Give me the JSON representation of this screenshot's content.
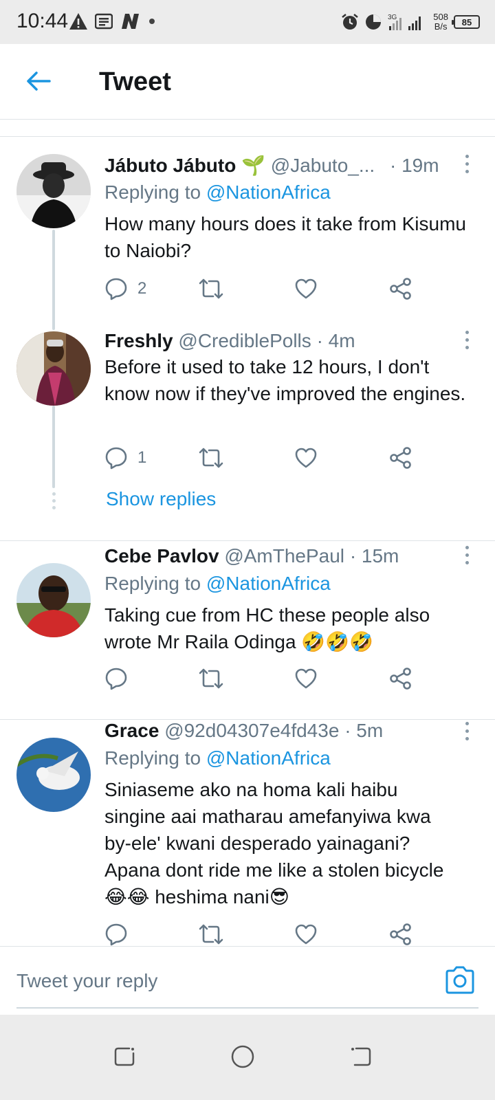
{
  "status_bar": {
    "time": "10:44",
    "net_speed_value": "508",
    "net_speed_unit": "B/s",
    "battery": "85",
    "network": "3G",
    "icons": [
      "warning-icon",
      "news-icon",
      "n-app-icon",
      "dot-icon",
      "alarm-icon",
      "data-saver-icon",
      "signal-icon",
      "battery-icon"
    ]
  },
  "header": {
    "title": "Tweet"
  },
  "tweets": [
    {
      "name": "Jábuto Jábuto",
      "emoji": "🌱",
      "handle": "@Jabuto_...",
      "time": "· 19m",
      "reply_prefix": "Replying to",
      "reply_to": "@NationAfrica",
      "text": "How many hours does it take from Kisumu to Naiobi?",
      "reply_count": "2"
    },
    {
      "name": "Freshly",
      "handle": "@CrediblePolls",
      "time": "· 4m",
      "text": "Before it used to take 12 hours, I don't know now if they've improved the engines.",
      "reply_count": "1",
      "show_replies": "Show replies"
    },
    {
      "name": "Cebe Pavlov",
      "handle": "@AmThePaul",
      "time": "· 15m",
      "reply_prefix": "Replying to",
      "reply_to": "@NationAfrica",
      "text_line1": "Taking cue from HC these people also",
      "text_line2": "wrote Mr Raila Odinga 🤣🤣🤣"
    },
    {
      "name": "Grace",
      "handle": "@92d04307e4fd43e",
      "time": "· 5m",
      "reply_prefix": "Replying to",
      "reply_to": "@NationAfrica",
      "text_line1": "Siniaseme ako na homa kali haibu",
      "text_line2": "singine aai matharau amefanyiwa kwa",
      "text_line3": "by-ele' kwani  desperado yainagani?",
      "text_line4": "Apana dont ride me like a stolen bicycle",
      "text_line5": "😂😂 heshima nani😎"
    }
  ],
  "reply_bar": {
    "placeholder": "Tweet your reply"
  },
  "colors": {
    "accent": "#1b95e0",
    "muted": "#657786",
    "text": "#14171a",
    "divider": "#dfe3e6"
  }
}
